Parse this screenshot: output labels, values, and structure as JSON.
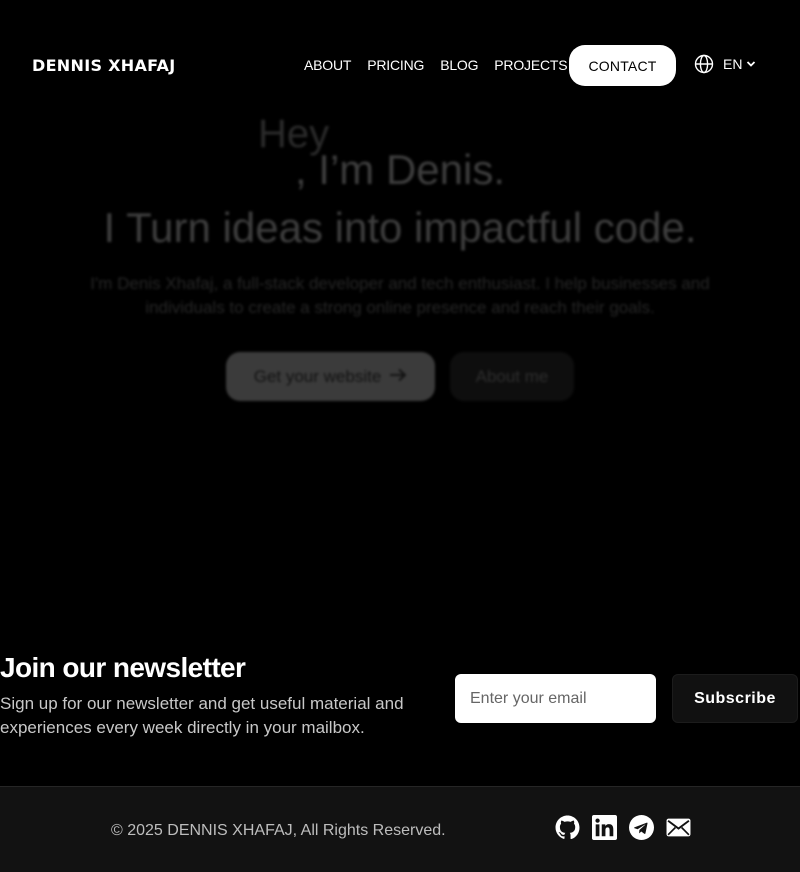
{
  "header": {
    "logo": "DENNIS XHAFAJ",
    "nav": [
      "ABOUT",
      "PRICING",
      "BLOG",
      "PROJECTS"
    ],
    "contact_label": "CONTACT",
    "language": "EN",
    "language_icon": "globe-icon"
  },
  "hero": {
    "greeting": "Hey",
    "intro": ", I’m Denis.",
    "headline": "I Turn ideas into impactful code.",
    "description": "I'm Denis Xhafaj, a full-stack developer and tech enthusiast. I help businesses and individuals to create a strong online presence and reach their goals.",
    "primary_button": "Get your website",
    "secondary_button": "About me"
  },
  "newsletter": {
    "title": "Join our newsletter",
    "text": "Sign up for our newsletter and get useful material and experiences every week directly in your mailbox.",
    "email_placeholder": "Enter your email",
    "subscribe_label": "Subscribe"
  },
  "footer": {
    "copyright": "© 2025 DENNIS XHAFAJ, All Rights Reserved.",
    "socials": [
      "github-icon",
      "linkedin-icon",
      "telegram-icon",
      "mail-icon"
    ]
  }
}
